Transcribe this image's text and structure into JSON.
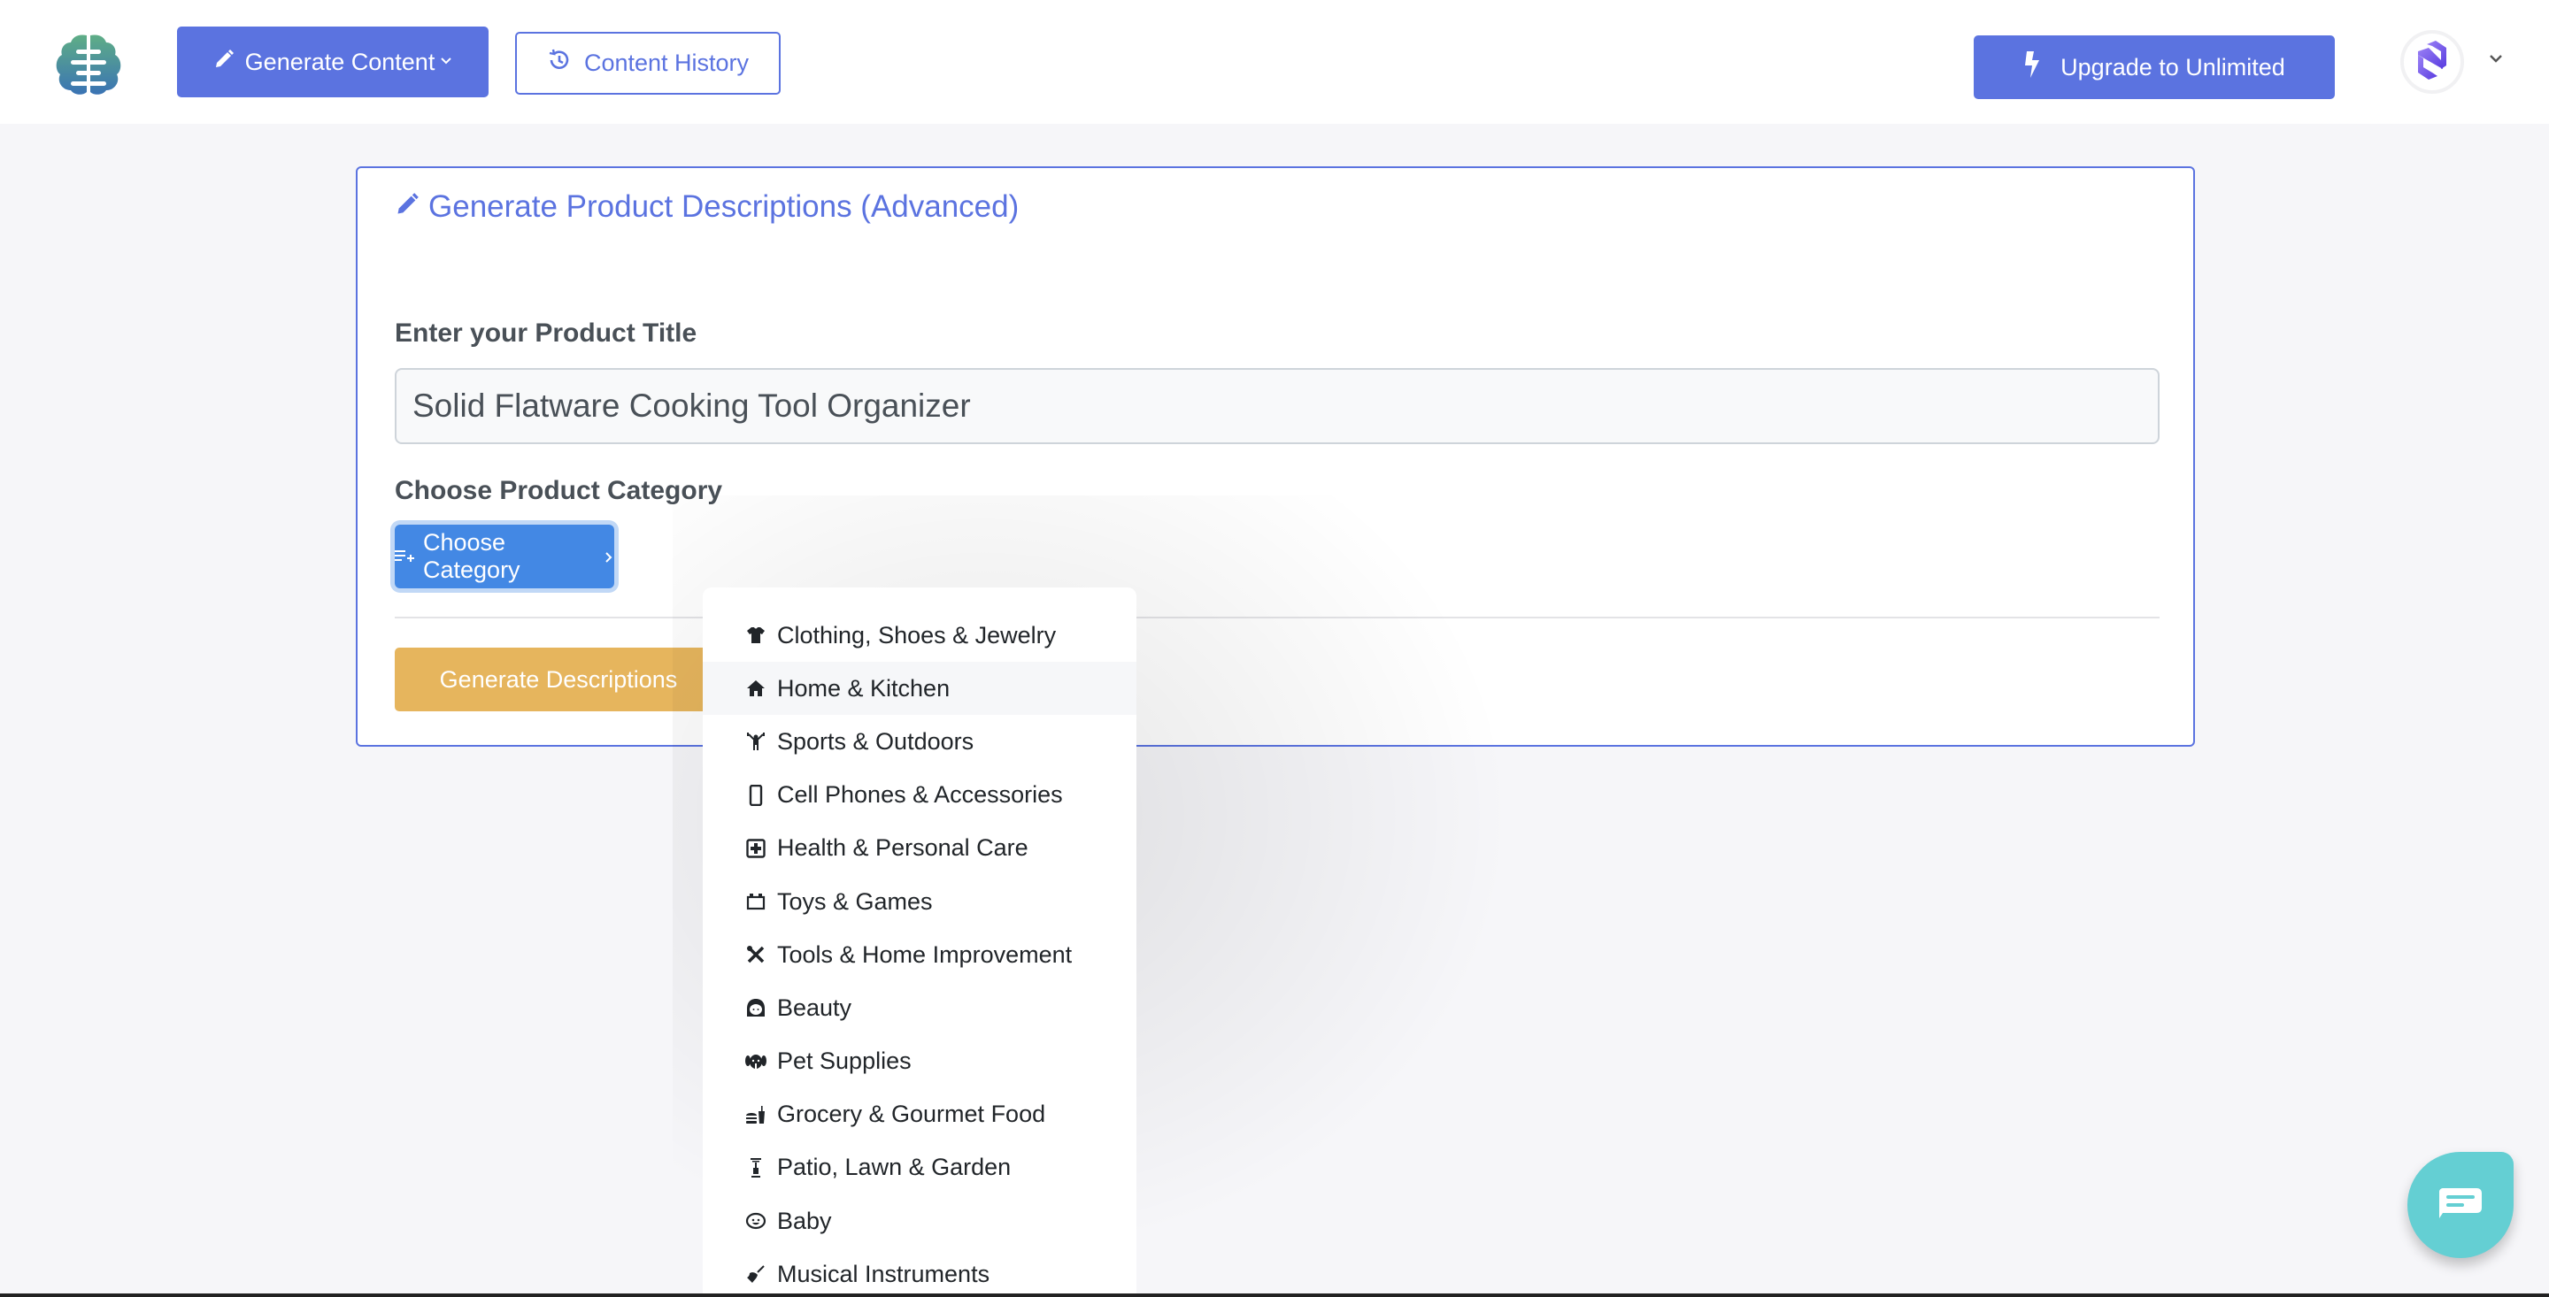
{
  "header": {
    "logo_icon": "brain-logo-icon",
    "generate_content_label": "Generate Content",
    "generate_content_icon": "pencil-icon",
    "content_history_label": "Content History",
    "content_history_icon": "history-icon",
    "upgrade_label": "Upgrade to Unlimited",
    "upgrade_icon": "bolt-icon",
    "avatar_icon": "user-brand-avatar-icon"
  },
  "card": {
    "title": "Generate Product Descriptions (Advanced)",
    "title_icon": "pencil-icon",
    "product_title_label": "Enter your Product Title",
    "product_title_value": "Solid Flatware Cooking Tool Organizer",
    "category_label": "Choose Product Category",
    "choose_category_button": "Choose Category",
    "generate_button": "Generate Descriptions"
  },
  "dropdown": {
    "highlighted_index": 1,
    "items": [
      {
        "label": "Clothing, Shoes & Jewelry",
        "icon": "shirt-icon"
      },
      {
        "label": "Home & Kitchen",
        "icon": "home-icon"
      },
      {
        "label": "Sports & Outdoors",
        "icon": "weightlifter-icon"
      },
      {
        "label": "Cell Phones & Accessories",
        "icon": "mobile-phone-icon"
      },
      {
        "label": "Health & Personal Care",
        "icon": "medical-kit-icon"
      },
      {
        "label": "Toys & Games",
        "icon": "toy-block-icon"
      },
      {
        "label": "Tools & Home Improvement",
        "icon": "tools-icon"
      },
      {
        "label": "Beauty",
        "icon": "woman-face-icon"
      },
      {
        "label": "Pet Supplies",
        "icon": "dog-icon"
      },
      {
        "label": "Grocery & Gourmet Food",
        "icon": "burger-drink-icon"
      },
      {
        "label": "Patio, Lawn & Garden",
        "icon": "patio-heater-icon"
      },
      {
        "label": "Baby",
        "icon": "baby-face-icon"
      },
      {
        "label": "Musical Instruments",
        "icon": "guitar-icon"
      }
    ]
  },
  "colors": {
    "primary": "#5b73e0",
    "category_button": "#4388e4",
    "generate_button": "#e6b55d",
    "chat": "#64cfd3",
    "background": "#f6f6f9"
  },
  "chat_widget_icon": "chat-bubble-icon"
}
